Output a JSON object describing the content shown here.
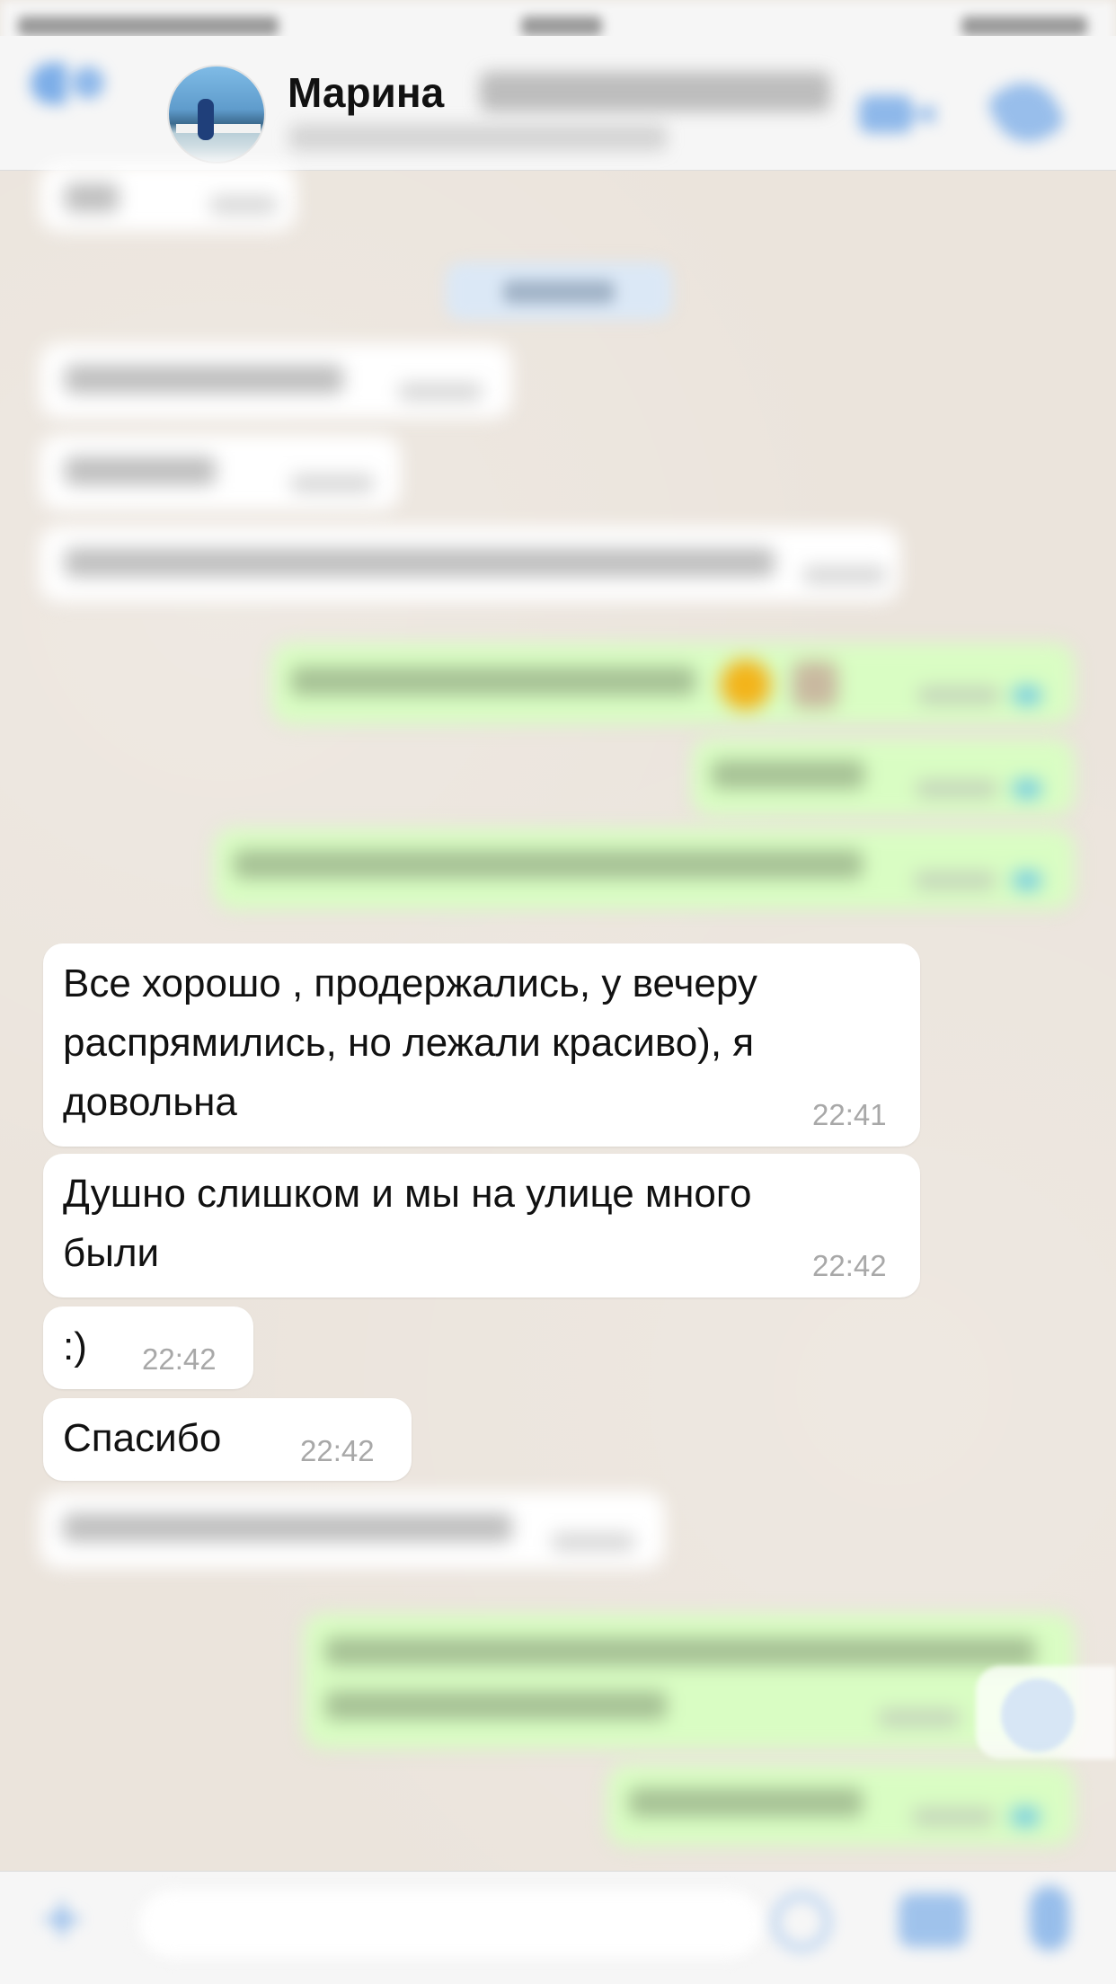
{
  "header": {
    "contact_name": "Марина"
  },
  "messages": [
    {
      "id": "m_all_good",
      "lines": [
        "Все хорошо , продержались, у вечеру",
        "распрямились, но лежали красиво), я",
        "довольна"
      ],
      "time": "22:41"
    },
    {
      "id": "m_stuffy",
      "lines": [
        "Душно слишком и мы на улице много",
        "были"
      ],
      "time": "22:42"
    },
    {
      "id": "m_smile",
      "lines": [
        ":)"
      ],
      "time": "22:42"
    },
    {
      "id": "m_thanks",
      "lines": [
        "Спасибо"
      ],
      "time": "22:42"
    }
  ],
  "colors": {
    "incoming_bubble": "#ffffff",
    "outgoing_bubble": "#d9fdc3",
    "accent": "#4a90e2",
    "read_tick": "#53bdeb"
  },
  "icons": [
    "back-icon",
    "video-call-icon",
    "phone-icon",
    "plus-icon",
    "sticker-icon",
    "camera-icon",
    "microphone-icon",
    "scroll-down-icon"
  ]
}
